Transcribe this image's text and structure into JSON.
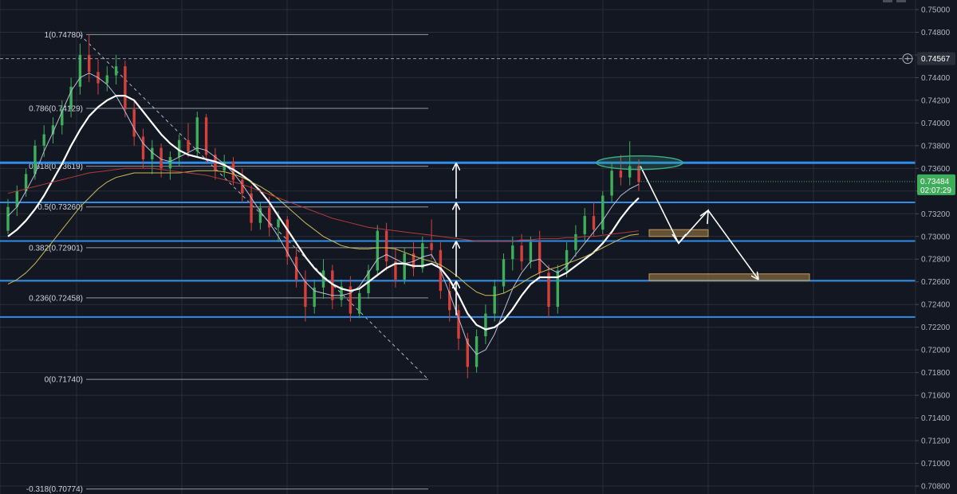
{
  "chart_data": {
    "type": "candlestick",
    "ylim": [
      0.708,
      0.75
    ],
    "y_ticks": [
      "0.75000",
      "0.74800",
      "0.74600",
      "0.74400",
      "0.74200",
      "0.74000",
      "0.73800",
      "0.73600",
      "0.73400",
      "0.73200",
      "0.73000",
      "0.72800",
      "0.72600",
      "0.72400",
      "0.72200",
      "0.72000",
      "0.71800",
      "0.71600",
      "0.71400",
      "0.71200",
      "0.71000",
      "0.70800"
    ],
    "crosshair": {
      "price": 0.74567,
      "label": "0.74567"
    },
    "last_price": {
      "price": 0.73484,
      "label": "0.73484",
      "countdown": "02:07:29"
    },
    "fib_levels": [
      {
        "ratio": 1,
        "price": 0.7478,
        "label": "1(0.74780)"
      },
      {
        "ratio": 0.786,
        "price": 0.74129,
        "label": "0.786(0.74129)"
      },
      {
        "ratio": 0.618,
        "price": 0.73619,
        "label": "0.618(0.73619)"
      },
      {
        "ratio": 0.5,
        "price": 0.7326,
        "label": "0.5(0.73260)"
      },
      {
        "ratio": 0.382,
        "price": 0.72901,
        "label": "0.382(0.72901)"
      },
      {
        "ratio": 0.236,
        "price": 0.72458,
        "label": "0.236(0.72458)"
      },
      {
        "ratio": 0,
        "price": 0.7174,
        "label": "0(0.71740)"
      },
      {
        "ratio": -0.318,
        "price": 0.70774,
        "label": "-0.318(0.70774)"
      }
    ],
    "horizontal_levels": [
      0.7365,
      0.733,
      0.7296,
      0.7261,
      0.7229
    ],
    "target_zones": [
      {
        "price_low": 0.73,
        "price_high": 0.7306
      },
      {
        "price_low": 0.7261,
        "price_high": 0.7267
      }
    ],
    "candles": [
      [
        0.7305,
        0.7333,
        0.7302,
        0.7326
      ],
      [
        0.7326,
        0.7345,
        0.7318,
        0.734
      ],
      [
        0.734,
        0.736,
        0.7335,
        0.7355
      ],
      [
        0.7355,
        0.7385,
        0.735,
        0.738
      ],
      [
        0.738,
        0.7398,
        0.737,
        0.739
      ],
      [
        0.739,
        0.7405,
        0.7382,
        0.7398
      ],
      [
        0.7398,
        0.742,
        0.739,
        0.7412
      ],
      [
        0.7412,
        0.744,
        0.7405,
        0.7432
      ],
      [
        0.7432,
        0.747,
        0.7425,
        0.746
      ],
      [
        0.746,
        0.7478,
        0.7436,
        0.7445
      ],
      [
        0.7445,
        0.7456,
        0.7425,
        0.7435
      ],
      [
        0.7435,
        0.745,
        0.7428,
        0.7442
      ],
      [
        0.7442,
        0.746,
        0.7434,
        0.745
      ],
      [
        0.745,
        0.7455,
        0.7405,
        0.7412
      ],
      [
        0.7412,
        0.742,
        0.738,
        0.7388
      ],
      [
        0.7388,
        0.7395,
        0.736,
        0.7368
      ],
      [
        0.7368,
        0.7385,
        0.7355,
        0.7378
      ],
      [
        0.7378,
        0.7382,
        0.7352,
        0.736
      ],
      [
        0.736,
        0.7375,
        0.735,
        0.737
      ],
      [
        0.737,
        0.739,
        0.7362,
        0.7385
      ],
      [
        0.7385,
        0.74,
        0.737,
        0.7375
      ],
      [
        0.7375,
        0.741,
        0.737,
        0.7405
      ],
      [
        0.7405,
        0.7408,
        0.7365,
        0.7372
      ],
      [
        0.7372,
        0.7378,
        0.735,
        0.7358
      ],
      [
        0.7358,
        0.7372,
        0.7352,
        0.7366
      ],
      [
        0.7366,
        0.737,
        0.7345,
        0.735
      ],
      [
        0.735,
        0.736,
        0.733,
        0.7338
      ],
      [
        0.7338,
        0.7345,
        0.7305,
        0.7312
      ],
      [
        0.7312,
        0.733,
        0.7306,
        0.7325
      ],
      [
        0.7325,
        0.7335,
        0.73,
        0.7308
      ],
      [
        0.7308,
        0.7322,
        0.7295,
        0.7315
      ],
      [
        0.7315,
        0.7318,
        0.7275,
        0.7282
      ],
      [
        0.7282,
        0.729,
        0.7255,
        0.7262
      ],
      [
        0.7262,
        0.727,
        0.7225,
        0.7238
      ],
      [
        0.7238,
        0.7262,
        0.7232,
        0.7255
      ],
      [
        0.7255,
        0.728,
        0.7245,
        0.727
      ],
      [
        0.727,
        0.7275,
        0.7236,
        0.7244
      ],
      [
        0.7244,
        0.7262,
        0.7238,
        0.7256
      ],
      [
        0.7256,
        0.7265,
        0.7225,
        0.7232
      ],
      [
        0.7232,
        0.7255,
        0.7228,
        0.725
      ],
      [
        0.725,
        0.7275,
        0.7245,
        0.727
      ],
      [
        0.727,
        0.731,
        0.7265,
        0.7305
      ],
      [
        0.7305,
        0.7312,
        0.727,
        0.7278
      ],
      [
        0.7278,
        0.729,
        0.7255,
        0.7262
      ],
      [
        0.7262,
        0.729,
        0.7258,
        0.7285
      ],
      [
        0.7285,
        0.7295,
        0.7265,
        0.7272
      ],
      [
        0.7272,
        0.73,
        0.7268,
        0.7294
      ],
      [
        0.7294,
        0.7315,
        0.728,
        0.7288
      ],
      [
        0.7288,
        0.7295,
        0.7245,
        0.7252
      ],
      [
        0.7252,
        0.726,
        0.7225,
        0.7235
      ],
      [
        0.7235,
        0.724,
        0.72,
        0.721
      ],
      [
        0.721,
        0.7215,
        0.7175,
        0.7185
      ],
      [
        0.7185,
        0.7218,
        0.718,
        0.7212
      ],
      [
        0.7212,
        0.724,
        0.7205,
        0.7232
      ],
      [
        0.7232,
        0.7262,
        0.7225,
        0.7256
      ],
      [
        0.7256,
        0.7285,
        0.725,
        0.728
      ],
      [
        0.728,
        0.73,
        0.727,
        0.7292
      ],
      [
        0.7292,
        0.7302,
        0.727,
        0.7278
      ],
      [
        0.7278,
        0.73,
        0.7272,
        0.7295
      ],
      [
        0.7295,
        0.7305,
        0.7262,
        0.7268
      ],
      [
        0.7268,
        0.7275,
        0.7228,
        0.7238
      ],
      [
        0.7238,
        0.7275,
        0.7232,
        0.727
      ],
      [
        0.727,
        0.7295,
        0.7264,
        0.7288
      ],
      [
        0.7288,
        0.731,
        0.7282,
        0.7302
      ],
      [
        0.7302,
        0.7325,
        0.7296,
        0.7318
      ],
      [
        0.7318,
        0.733,
        0.73,
        0.7306
      ],
      [
        0.7306,
        0.734,
        0.7302,
        0.7336
      ],
      [
        0.7336,
        0.7365,
        0.733,
        0.7358
      ],
      [
        0.7358,
        0.7372,
        0.7345,
        0.7352
      ],
      [
        0.7352,
        0.7384,
        0.7345,
        0.7362
      ],
      [
        0.7362,
        0.7368,
        0.734,
        0.7348
      ]
    ],
    "moving_averages": [
      {
        "color": "#b7bfd6",
        "width": 1,
        "values": [
          0.7318,
          0.7326,
          0.734,
          0.7355,
          0.7375,
          0.7392,
          0.741,
          0.7428,
          0.744,
          0.7444,
          0.744,
          0.7434,
          0.7424,
          0.741,
          0.7395,
          0.7382,
          0.7374,
          0.7368,
          0.7366,
          0.737,
          0.7374,
          0.7378,
          0.7376,
          0.737,
          0.7364,
          0.7356,
          0.7346,
          0.7334,
          0.7322,
          0.7312,
          0.73,
          0.7286,
          0.7272,
          0.726,
          0.7252,
          0.725,
          0.7248,
          0.7248,
          0.725,
          0.7256,
          0.7268,
          0.728,
          0.7284,
          0.728,
          0.7276,
          0.7278,
          0.7282,
          0.7284,
          0.727,
          0.725,
          0.7228,
          0.7206,
          0.7196,
          0.72,
          0.7214,
          0.7234,
          0.7254,
          0.7268,
          0.7278,
          0.728,
          0.7272,
          0.7268,
          0.7274,
          0.7284,
          0.7294,
          0.7304,
          0.7314,
          0.7326,
          0.7336,
          0.7342,
          0.7346
        ]
      },
      {
        "color": "#ffffff",
        "width": 2.2,
        "values": [
          0.73,
          0.7306,
          0.7314,
          0.7324,
          0.7336,
          0.735,
          0.7364,
          0.738,
          0.7394,
          0.7406,
          0.7414,
          0.742,
          0.7424,
          0.7424,
          0.742,
          0.741,
          0.74,
          0.739,
          0.7382,
          0.7376,
          0.7372,
          0.737,
          0.7368,
          0.7366,
          0.7363,
          0.7359,
          0.7354,
          0.7348,
          0.734,
          0.733,
          0.7318,
          0.7306,
          0.7294,
          0.7282,
          0.7272,
          0.7264,
          0.7258,
          0.7254,
          0.7252,
          0.7254,
          0.726,
          0.7266,
          0.7272,
          0.7276,
          0.7276,
          0.7274,
          0.7274,
          0.7276,
          0.7272,
          0.7262,
          0.7248,
          0.7232,
          0.7222,
          0.7218,
          0.722,
          0.7226,
          0.7236,
          0.7248,
          0.7258,
          0.7264,
          0.7264,
          0.7264,
          0.7268,
          0.7274,
          0.728,
          0.7286,
          0.7294,
          0.7304,
          0.7316,
          0.7326,
          0.7334
        ]
      },
      {
        "color": "#c9bb55",
        "width": 1,
        "values": [
          0.7258,
          0.7262,
          0.7268,
          0.7276,
          0.7286,
          0.7296,
          0.7306,
          0.7316,
          0.7326,
          0.7334,
          0.7342,
          0.7348,
          0.7352,
          0.7354,
          0.7356,
          0.7356,
          0.7356,
          0.7356,
          0.7356,
          0.7356,
          0.7357,
          0.7358,
          0.7358,
          0.7358,
          0.7357,
          0.7355,
          0.7352,
          0.7348,
          0.7344,
          0.7339,
          0.7333,
          0.7326,
          0.7319,
          0.7312,
          0.7306,
          0.73,
          0.7296,
          0.7292,
          0.729,
          0.7289,
          0.7289,
          0.729,
          0.729,
          0.7289,
          0.7286,
          0.7283,
          0.728,
          0.7278,
          0.7275,
          0.727,
          0.7264,
          0.7257,
          0.7251,
          0.7248,
          0.7248,
          0.725,
          0.7254,
          0.7259,
          0.7264,
          0.7268,
          0.7271,
          0.7273,
          0.7276,
          0.7279,
          0.7282,
          0.7286,
          0.729,
          0.7294,
          0.7298,
          0.7301,
          0.7302
        ]
      },
      {
        "color": "#b23a3a",
        "width": 1,
        "values": [
          0.7338,
          0.734,
          0.7342,
          0.7344,
          0.7346,
          0.7348,
          0.735,
          0.7352,
          0.7354,
          0.7356,
          0.7357,
          0.7358,
          0.7359,
          0.736,
          0.736,
          0.736,
          0.736,
          0.7359,
          0.7358,
          0.7357,
          0.7356,
          0.7355,
          0.7354,
          0.7352,
          0.735,
          0.7348,
          0.7346,
          0.7343,
          0.734,
          0.7337,
          0.7334,
          0.7331,
          0.7328,
          0.7325,
          0.7322,
          0.7319,
          0.7316,
          0.7314,
          0.7312,
          0.731,
          0.7308,
          0.7307,
          0.7306,
          0.7305,
          0.7304,
          0.7303,
          0.7302,
          0.7301,
          0.73,
          0.7299,
          0.7298,
          0.7297,
          0.7296,
          0.7296,
          0.7296,
          0.7296,
          0.7296,
          0.7297,
          0.7297,
          0.7298,
          0.7298,
          0.7298,
          0.7299,
          0.7299,
          0.73,
          0.73,
          0.7301,
          0.7302,
          0.7303,
          0.7304,
          0.7305
        ]
      }
    ],
    "colors": {
      "background": "#131722",
      "grid": "#2a2e39",
      "up_candle": "#3fae5b",
      "down_candle": "#d5403b",
      "level_line": "#2f8ce8",
      "target_zone": "#c79b54",
      "ellipse": "#3fae86",
      "last_price_badge": "#3fae5b",
      "axis_text": "#b2b5be"
    }
  }
}
